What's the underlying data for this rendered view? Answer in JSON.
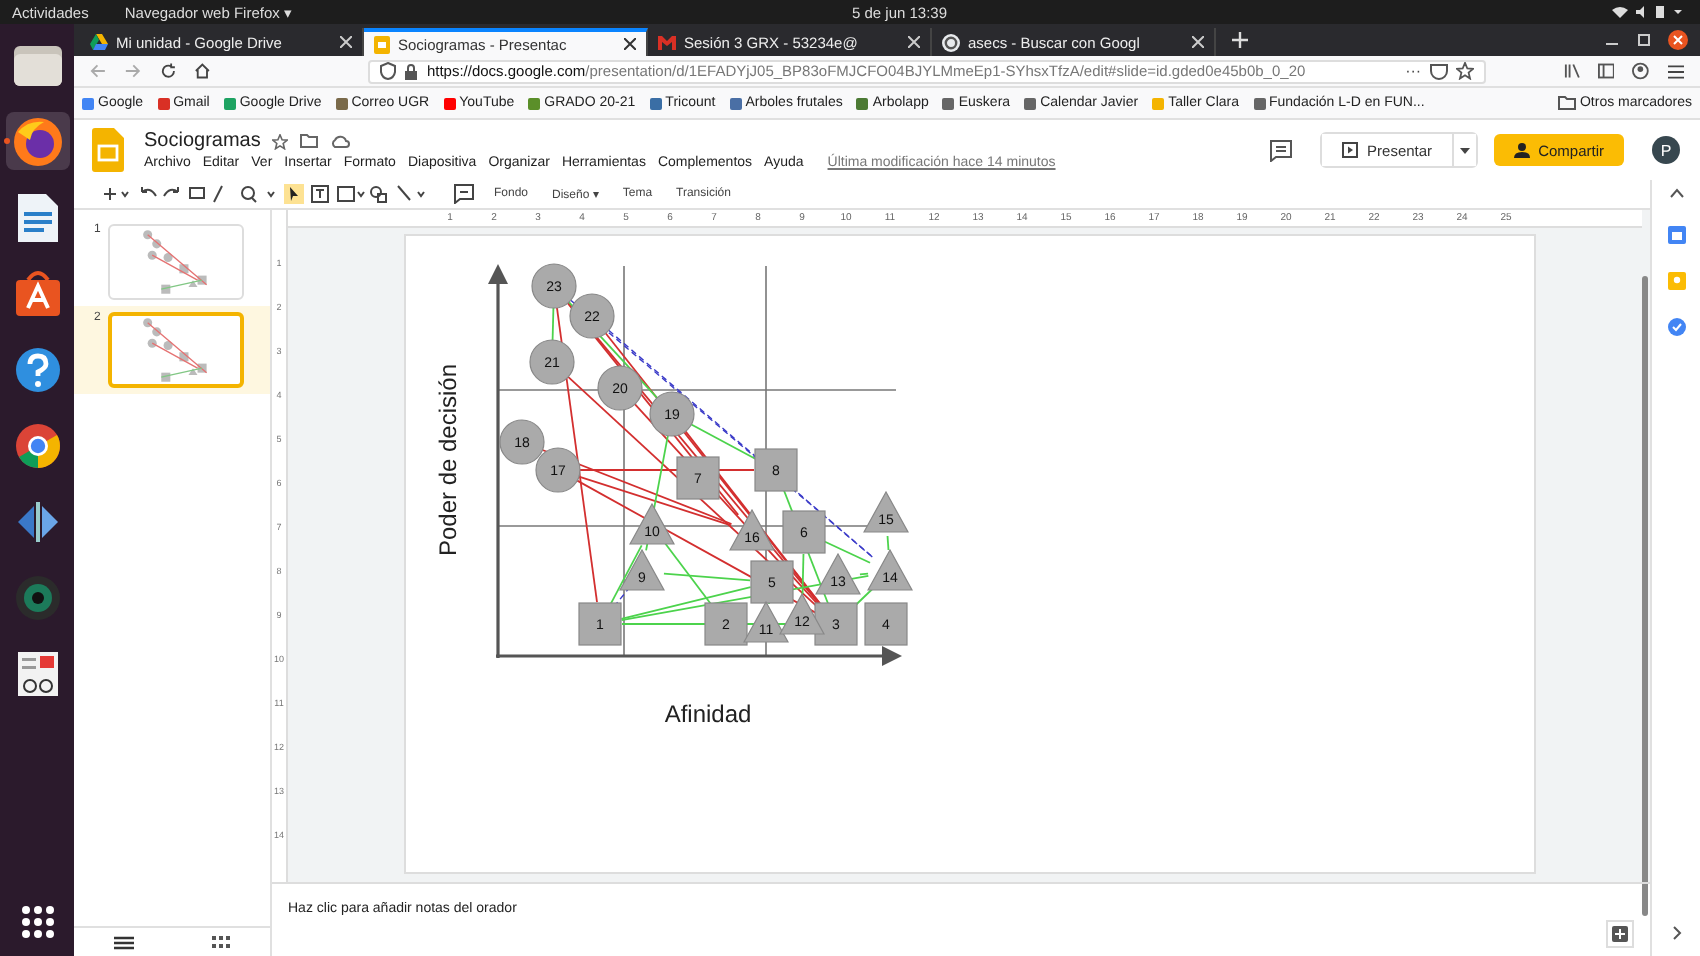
{
  "top_bar": {
    "activities": "Actividades",
    "app_menu": "Navegador web Firefox ▾",
    "clock": "5 de jun  13:39"
  },
  "dock": {
    "items": [
      {
        "kind": "files",
        "active": false
      },
      {
        "kind": "firefox",
        "active": true
      },
      {
        "kind": "writer",
        "active": false
      },
      {
        "kind": "store",
        "active": false
      },
      {
        "kind": "help",
        "active": false
      },
      {
        "kind": "chrome",
        "active": false
      },
      {
        "kind": "arrows",
        "active": false
      },
      {
        "kind": "camera",
        "active": false
      },
      {
        "kind": "viewer",
        "active": false
      }
    ]
  },
  "browser": {
    "tabs": [
      {
        "label": "Mi unidad - Google Drive",
        "kind": "drive",
        "selected": false
      },
      {
        "label": "Sociogramas - Presentac",
        "kind": "slides",
        "selected": true
      },
      {
        "label": "Sesión 3 GRX - 53234e@",
        "kind": "mail",
        "selected": false
      },
      {
        "label": "asecs - Buscar con Googl",
        "kind": "google",
        "selected": false
      }
    ],
    "url": {
      "domain": "https://docs.google.com",
      "path": "/presentation/d/1EFADYjJ05_BP83oFMJCFO04BJYLMmeEp1-SYhsxTfzA/edit#slide=id.gded0e45b0b_0_20"
    },
    "url_more": "···",
    "bookmarks": [
      {
        "label": "Google",
        "color": "#4285f4"
      },
      {
        "label": "Gmail",
        "color": "#d93025"
      },
      {
        "label": "Google Drive",
        "color": "#1ea362"
      },
      {
        "label": "Correo UGR",
        "color": "#7a6a4a"
      },
      {
        "label": "YouTube",
        "color": "#ff0000"
      },
      {
        "label": "GRADO 20-21",
        "color": "#5b8f29"
      },
      {
        "label": "Tricount",
        "color": "#3a6ea5"
      },
      {
        "label": "Arboles frutales",
        "color": "#4a6fa5"
      },
      {
        "label": "Arbolapp",
        "color": "#4c7a34"
      },
      {
        "label": "Euskera",
        "color": "#666666"
      },
      {
        "label": "Calendar Javier",
        "color": "#666666"
      },
      {
        "label": "Taller Clara",
        "color": "#f4b400"
      },
      {
        "label": "Fundación L-D en FUN...",
        "color": "#666666"
      }
    ],
    "other_bookmarks": "Otros marcadores"
  },
  "doc": {
    "title": "Sociogramas",
    "menu": [
      "Archivo",
      "Editar",
      "Ver",
      "Insertar",
      "Formato",
      "Diapositiva",
      "Organizar",
      "Herramientas",
      "Complementos",
      "Ayuda"
    ],
    "last_edit": "Última modificación hace 14 minutos",
    "present": "Presentar",
    "share": "Compartir",
    "avatar": "P"
  },
  "toolbar": {
    "text_buttons": [
      "Fondo",
      "Diseño ▾",
      "Tema",
      "Transición"
    ]
  },
  "filmstrip": [
    {
      "number": "1",
      "selected": false
    },
    {
      "number": "2",
      "selected": true
    }
  ],
  "ruler": {
    "horizontal": [
      "1",
      "2",
      "3",
      "4",
      "5",
      "6",
      "7",
      "8",
      "9",
      "10",
      "11",
      "12",
      "13",
      "14",
      "15",
      "16",
      "17",
      "18",
      "19",
      "20",
      "21",
      "22",
      "23",
      "24",
      "25"
    ],
    "vertical": [
      "1",
      "2",
      "3",
      "4",
      "5",
      "6",
      "7",
      "8",
      "9",
      "10",
      "11",
      "12",
      "13",
      "14"
    ]
  },
  "slide": {
    "y_axis_label": "Poder de decisión",
    "x_axis_label": "Afinidad",
    "nodes": [
      {
        "label": "1",
        "kind": "square"
      },
      {
        "label": "2",
        "kind": "square"
      },
      {
        "label": "3",
        "kind": "square"
      },
      {
        "label": "4",
        "kind": "square"
      },
      {
        "label": "5",
        "kind": "square"
      },
      {
        "label": "6",
        "kind": "square"
      },
      {
        "label": "7",
        "kind": "square"
      },
      {
        "label": "8",
        "kind": "square"
      },
      {
        "label": "9",
        "kind": "triangle"
      },
      {
        "label": "10",
        "kind": "triangle"
      },
      {
        "label": "11",
        "kind": "triangle"
      },
      {
        "label": "12",
        "kind": "triangle"
      },
      {
        "label": "13",
        "kind": "triangle"
      },
      {
        "label": "15",
        "kind": "triangle"
      },
      {
        "label": "14",
        "kind": "triangle"
      },
      {
        "label": "16",
        "kind": "triangle"
      },
      {
        "label": "17",
        "kind": "circle"
      },
      {
        "label": "18",
        "kind": "circle"
      },
      {
        "label": "19",
        "kind": "circle"
      },
      {
        "label": "20",
        "kind": "circle"
      },
      {
        "label": "21",
        "kind": "circle"
      },
      {
        "label": "22",
        "kind": "circle"
      },
      {
        "label": "23",
        "kind": "circle"
      }
    ]
  },
  "notes": {
    "placeholder": "Haz clic para añadir notas del orador"
  }
}
